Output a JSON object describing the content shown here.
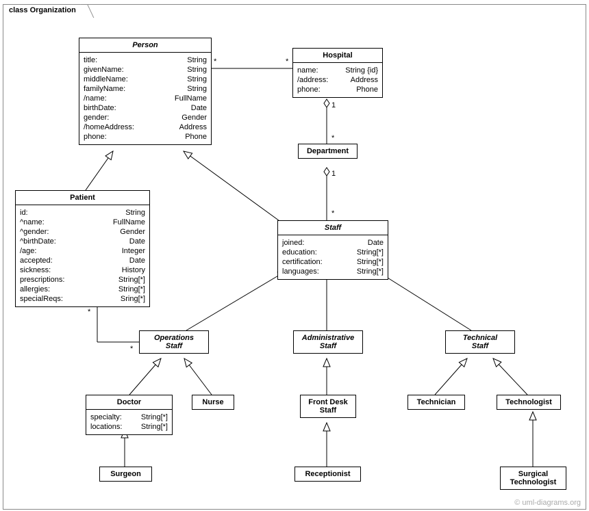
{
  "frame": {
    "title": "class Organization"
  },
  "watermark": "© uml-diagrams.org",
  "classes": {
    "person": {
      "name": "Person",
      "attrs": [
        [
          "title:",
          "String"
        ],
        [
          "givenName:",
          "String"
        ],
        [
          "middleName:",
          "String"
        ],
        [
          "familyName:",
          "String"
        ],
        [
          "/name:",
          "FullName"
        ],
        [
          "birthDate:",
          "Date"
        ],
        [
          "gender:",
          "Gender"
        ],
        [
          "/homeAddress:",
          "Address"
        ],
        [
          "phone:",
          "Phone"
        ]
      ]
    },
    "hospital": {
      "name": "Hospital",
      "attrs": [
        [
          "name:",
          "String {id}"
        ],
        [
          "/address:",
          "Address"
        ],
        [
          "phone:",
          "Phone"
        ]
      ]
    },
    "department": {
      "name": "Department"
    },
    "patient": {
      "name": "Patient",
      "attrs": [
        [
          "id:",
          "String"
        ],
        [
          "^name:",
          "FullName"
        ],
        [
          "^gender:",
          "Gender"
        ],
        [
          "^birthDate:",
          "Date"
        ],
        [
          "/age:",
          "Integer"
        ],
        [
          "accepted:",
          "Date"
        ],
        [
          "sickness:",
          "History"
        ],
        [
          "prescriptions:",
          "String[*]"
        ],
        [
          "allergies:",
          "String[*]"
        ],
        [
          "specialReqs:",
          "Sring[*]"
        ]
      ]
    },
    "staff": {
      "name": "Staff",
      "attrs": [
        [
          "joined:",
          "Date"
        ],
        [
          "education:",
          "String[*]"
        ],
        [
          "certification:",
          "String[*]"
        ],
        [
          "languages:",
          "String[*]"
        ]
      ]
    },
    "opsStaff": {
      "name1": "Operations",
      "name2": "Staff"
    },
    "adminStaff": {
      "name1": "Administrative",
      "name2": "Staff"
    },
    "techStaff": {
      "name1": "Technical",
      "name2": "Staff"
    },
    "doctor": {
      "name": "Doctor",
      "attrs": [
        [
          "specialty:",
          "String[*]"
        ],
        [
          "locations:",
          "String[*]"
        ]
      ]
    },
    "nurse": {
      "name": "Nurse"
    },
    "frontDesk": {
      "name1": "Front Desk",
      "name2": "Staff"
    },
    "receptionist": {
      "name": "Receptionist"
    },
    "technician": {
      "name": "Technician"
    },
    "technologist": {
      "name": "Technologist"
    },
    "surgeon": {
      "name": "Surgeon"
    },
    "surgTech": {
      "name1": "Surgical",
      "name2": "Technologist"
    }
  },
  "mult": {
    "star": "*",
    "one": "1"
  }
}
